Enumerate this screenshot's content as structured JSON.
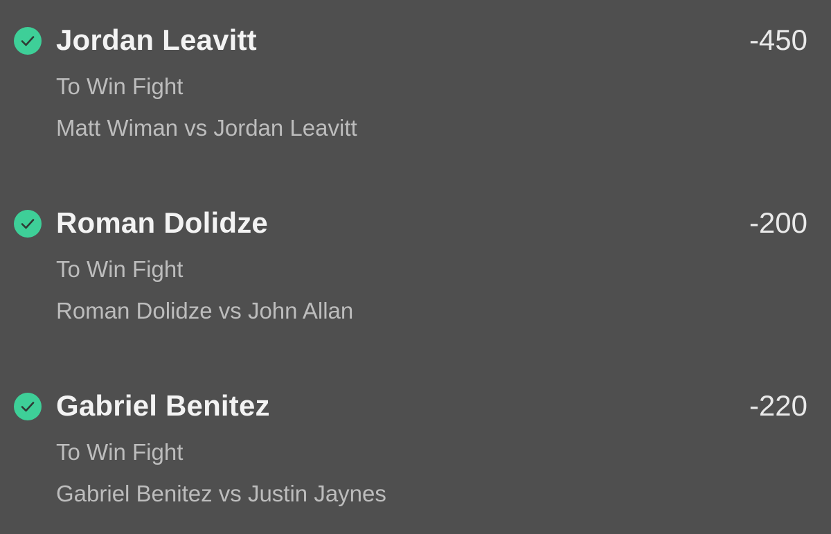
{
  "colors": {
    "background": "#4f4f4f",
    "check_icon_fill": "#3ecf98",
    "check_mark": "#2f3a35",
    "selection_text": "#f3f3f3",
    "odds_text": "#e9e9e9",
    "secondary_text": "#bdbdbd"
  },
  "bets": [
    {
      "status_icon": "check-circle-icon",
      "selection": "Jordan Leavitt",
      "odds": "-450",
      "market": "To Win Fight",
      "event": "Matt Wiman vs Jordan Leavitt"
    },
    {
      "status_icon": "check-circle-icon",
      "selection": "Roman Dolidze",
      "odds": "-200",
      "market": "To Win Fight",
      "event": "Roman Dolidze vs John Allan"
    },
    {
      "status_icon": "check-circle-icon",
      "selection": "Gabriel Benitez",
      "odds": "-220",
      "market": "To Win Fight",
      "event": "Gabriel Benitez vs Justin Jaynes"
    }
  ]
}
